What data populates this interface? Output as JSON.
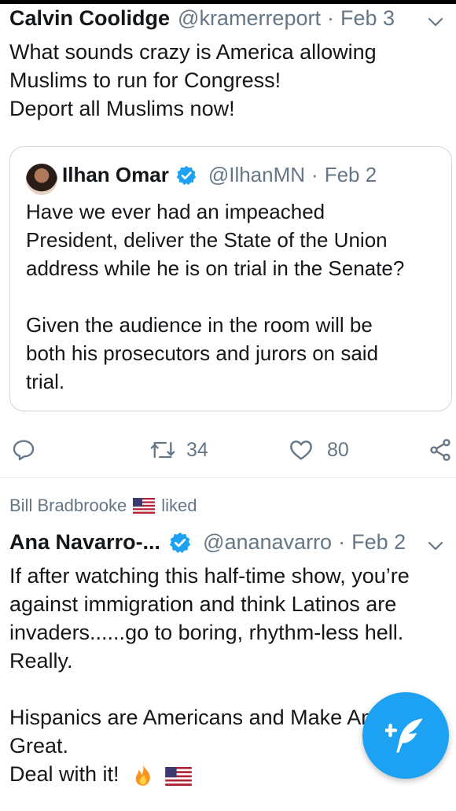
{
  "tweet1": {
    "name": "Calvin Coolidge",
    "handle": "@kramerreport",
    "dot": "·",
    "time": "Feb 3",
    "text": "What sounds crazy is America allowing\nMuslims to run for Congress!\nDeport all Muslims now!",
    "quote": {
      "name": "Ilhan Omar",
      "handle": "@IlhanMN",
      "dot": "·",
      "time": "Feb 2",
      "text": "Have we ever had an impeached\nPresident, deliver the State of the Union\naddress while he is on trial in the Senate?\n\nGiven the audience in the room will be\nboth his prosecutors and jurors on said\ntrial."
    },
    "actions": {
      "retweets": "34",
      "likes": "80"
    }
  },
  "social_context": {
    "user": "Bill Bradbrooke",
    "verb": "liked"
  },
  "tweet2": {
    "name": "Ana Navarro-...",
    "handle": "@ananavarro",
    "dot": "·",
    "time": "Feb 2",
    "text": "If after watching this half-time show, you’re\nagainst immigration and think Latinos are\ninvaders......go to boring, rhythm-less hell.\nReally.\n\nHispanics are Americans and Make America\nGreat.\nDeal with it!"
  },
  "icons": {
    "reply": "reply-icon",
    "retweet": "retweet-icon",
    "like": "heart-icon",
    "share": "share-icon",
    "compose": "compose-tweet-icon",
    "verified": "verified-badge-icon",
    "caret": "chevron-down-icon"
  },
  "colors": {
    "accent": "#1da1f2",
    "muted": "#657786",
    "text": "#14171a",
    "border": "#ccd6dd"
  }
}
